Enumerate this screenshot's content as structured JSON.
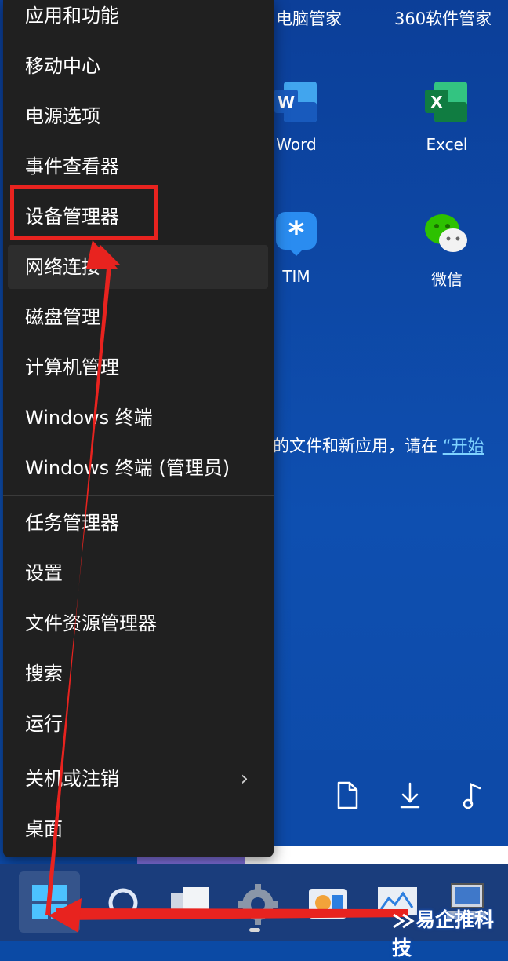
{
  "desktop": {
    "top_labels": [
      "电脑管家",
      "360软件管家"
    ],
    "apps": [
      {
        "name": "Word",
        "icon": "word-icon"
      },
      {
        "name": "Excel",
        "icon": "excel-icon"
      },
      {
        "name": "TIM",
        "icon": "tim-icon"
      },
      {
        "name": "微信",
        "icon": "wechat-icon"
      }
    ],
    "info_text": "的文件和新应用，请在",
    "info_link": "“开始",
    "bottom_icons": [
      "document-icon",
      "download-icon",
      "music-icon"
    ],
    "progress_fraction": 0.29
  },
  "menu": {
    "items": [
      "应用和功能",
      "移动中心",
      "电源选项",
      "事件查看器",
      "设备管理器",
      "网络连接",
      "磁盘管理",
      "计算机管理",
      "Windows 终端",
      "Windows 终端 (管理员)",
      "任务管理器",
      "设置",
      "文件资源管理器",
      "搜索",
      "运行",
      "关机或注销",
      "桌面"
    ],
    "submenu_chevron": "›"
  },
  "taskbar": {
    "icons": [
      "start-icon",
      "search-icon",
      "task-view-icon",
      "settings-icon",
      "app-icon",
      "monitor-app-icon",
      "computer-icon"
    ]
  },
  "watermark": "易企推科技",
  "colors": {
    "menu_bg": "#202020",
    "desktop_blue": "#0d4aa8",
    "highlight_red": "#e8231f",
    "link": "#7fd3ff"
  }
}
